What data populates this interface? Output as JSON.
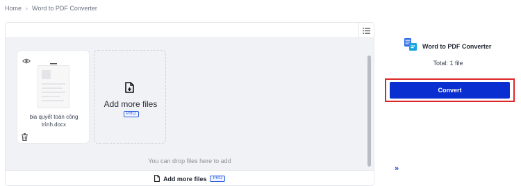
{
  "breadcrumb": {
    "home": "Home",
    "separator": "›",
    "current": "Word to PDF Converter"
  },
  "toolbar": {
    "view_icon": "list-view-icon"
  },
  "file": {
    "name": "bia quyết toán công trình.docx",
    "icons": [
      "eye-icon",
      "drag-handle-icon",
      "trash-icon"
    ]
  },
  "add_more": {
    "label": "Add more files",
    "badge": "PRO",
    "icon": "file-add-icon"
  },
  "drop_hint": "You can drop files here to add",
  "bottom_bar": {
    "label": "Add more files",
    "badge": "PRO",
    "icon": "file-icon"
  },
  "sidebar": {
    "tool_name": "Word to PDF Converter",
    "tool_icon": "word-to-pdf-icon",
    "total": "Total: 1 file",
    "convert_label": "Convert",
    "collapse_icon": "double-chevron-right-icon"
  },
  "colors": {
    "accent": "#0a2fd0",
    "highlight": "#dc2626",
    "pro": "#2c5ee0"
  }
}
